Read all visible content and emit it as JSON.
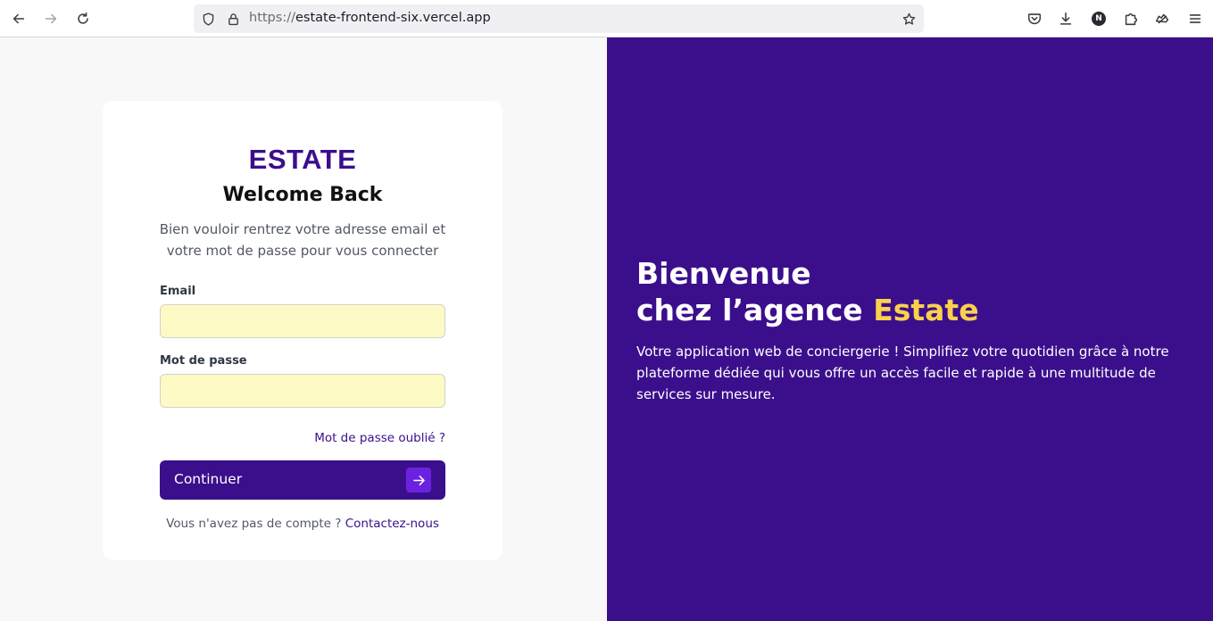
{
  "browser": {
    "url_scheme": "https://",
    "url_host": "estate-frontend-six.vercel.app",
    "profile_initial": "N"
  },
  "login": {
    "brand": "ESTATE",
    "heading": "Welcome Back",
    "subtitle": "Bien vouloir rentrez votre adresse email et votre mot de passe pour vous connecter",
    "email_label": "Email",
    "email_value": "",
    "password_label": "Mot de passe",
    "password_value": "",
    "forgot_link": "Mot de passe oublié ?",
    "continue_label": "Continuer",
    "no_account_text": "Vous n'avez pas de compte ?",
    "contact_link": "Contactez-nous"
  },
  "hero": {
    "title_line1": "Bienvenue",
    "title_line2": "chez l’agence",
    "title_accent": "Estate",
    "description": "Votre application web de conciergerie ! Simplifiez votre quotidien grâce à notre plateforme dédiée qui vous offre un accès facile et rapide à une multitude de services sur mesure."
  },
  "colors": {
    "primary": "#3b0f8c",
    "accent": "#fbd14b",
    "input_bg": "#fefac6"
  },
  "icons": {
    "back": "arrow-left-icon",
    "forward": "arrow-right-icon",
    "reload": "reload-icon",
    "tracking": "shield-icon",
    "secure": "lock-icon",
    "bookmark": "star-icon",
    "pocket": "pocket-icon",
    "downloads": "download-icon",
    "extensions": "puzzle-icon",
    "menu": "hamburger-menu-icon",
    "continue": "arrow-right-icon"
  }
}
